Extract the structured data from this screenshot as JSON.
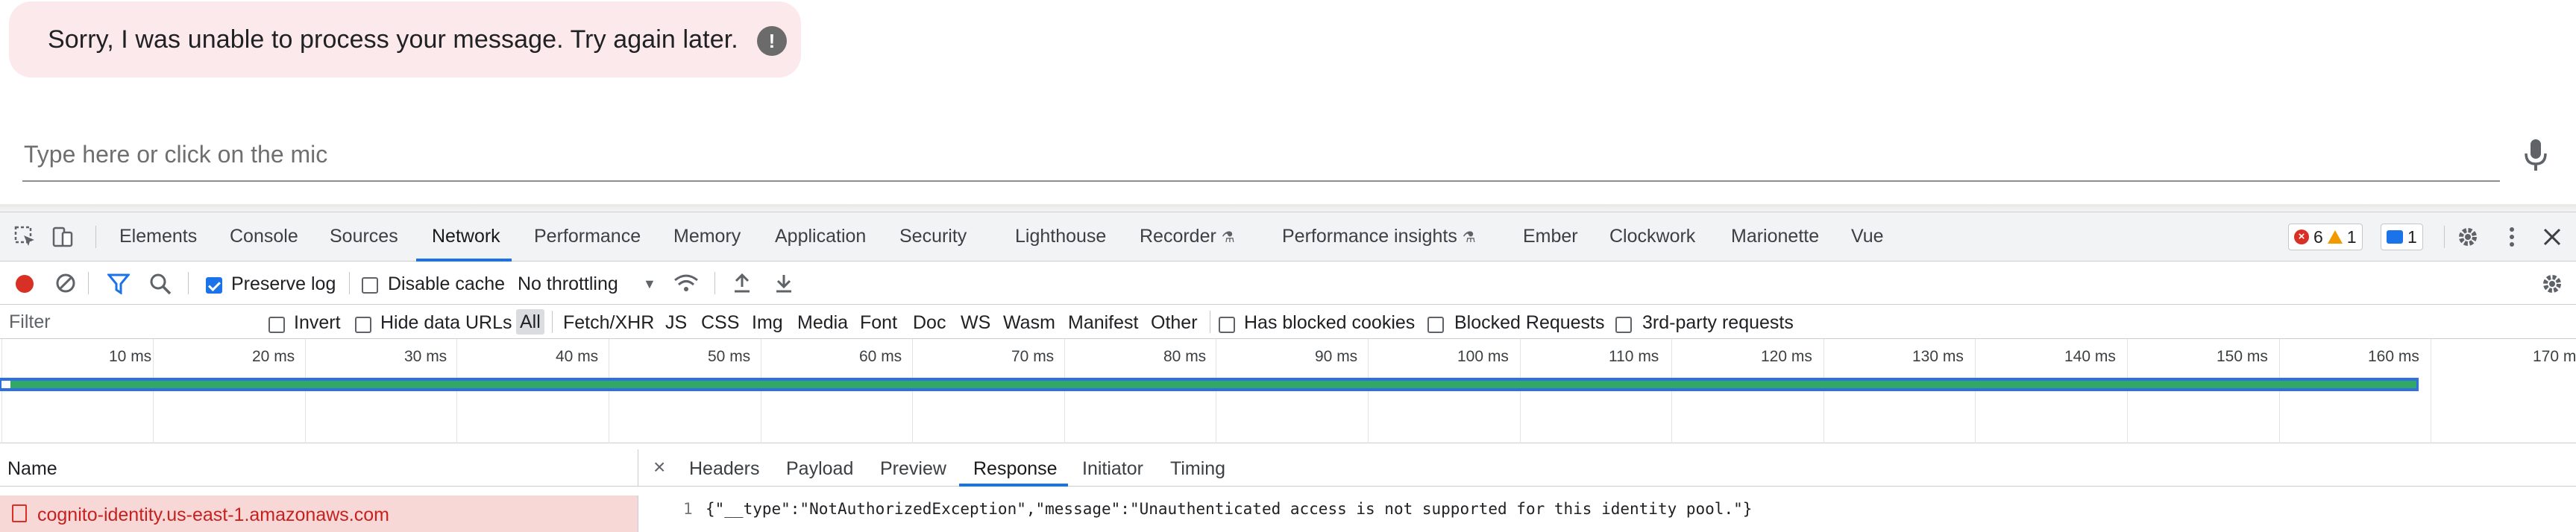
{
  "chat": {
    "error_message": "Sorry, I was unable to process your message. Try again later.",
    "error_icon": "exclamation-icon",
    "input_placeholder": "Type here or click on the mic",
    "mic_icon": "microphone-icon"
  },
  "devtools": {
    "tabs": [
      "Elements",
      "Console",
      "Sources",
      "Network",
      "Performance",
      "Memory",
      "Application",
      "Security",
      "Lighthouse",
      "Recorder",
      "Performance insights",
      "Ember",
      "Clockwork",
      "Marionette",
      "Vue"
    ],
    "active_tab": "Network",
    "badges": {
      "errors": "6",
      "warnings": "1",
      "messages": "1"
    },
    "toolbar": {
      "preserve_log": "Preserve log",
      "preserve_log_checked": true,
      "disable_cache": "Disable cache",
      "disable_cache_checked": false,
      "throttling": "No throttling"
    },
    "filterbar": {
      "placeholder": "Filter",
      "invert": "Invert",
      "hide_data_urls": "Hide data URLs",
      "types": [
        "All",
        "Fetch/XHR",
        "JS",
        "CSS",
        "Img",
        "Media",
        "Font",
        "Doc",
        "WS",
        "Wasm",
        "Manifest",
        "Other"
      ],
      "has_blocked_cookies": "Has blocked cookies",
      "blocked_requests": "Blocked Requests",
      "third_party": "3rd-party requests"
    },
    "timeline_ticks": [
      "10 ms",
      "20 ms",
      "30 ms",
      "40 ms",
      "50 ms",
      "60 ms",
      "70 ms",
      "80 ms",
      "90 ms",
      "100 ms",
      "110 ms",
      "120 ms",
      "130 ms",
      "140 ms",
      "150 ms",
      "160 ms",
      "170 m"
    ],
    "request_list": {
      "header": "Name",
      "rows": [
        "cognito-identity.us-east-1.amazonaws.com"
      ]
    },
    "detail": {
      "tabs": [
        "Headers",
        "Payload",
        "Preview",
        "Response",
        "Initiator",
        "Timing"
      ],
      "active_tab": "Response",
      "line_number": "1",
      "response_body": "{\"__type\":\"NotAuthorizedException\",\"message\":\"Unauthenticated access is not supported for this identity pool.\"}"
    }
  }
}
